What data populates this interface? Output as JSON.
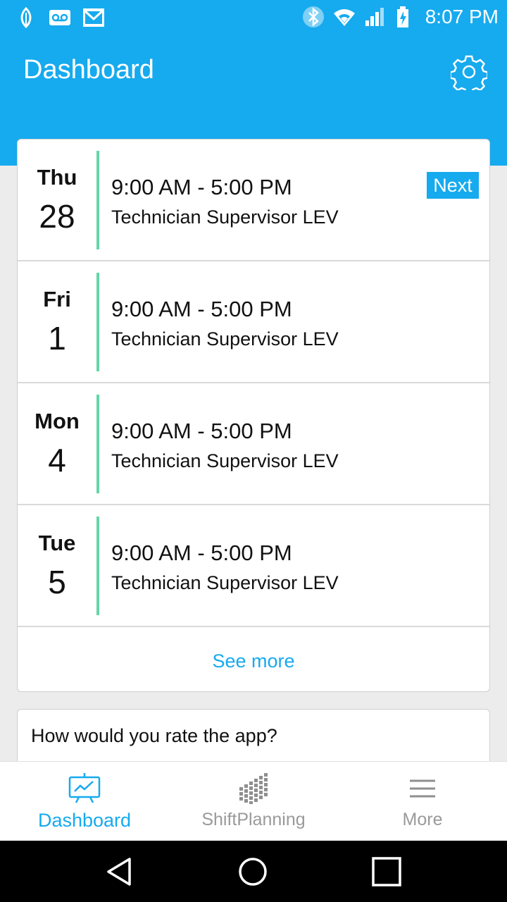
{
  "status_bar": {
    "time": "8:07 PM"
  },
  "header": {
    "title": "Dashboard"
  },
  "shifts": [
    {
      "day": "Thu",
      "date": "28",
      "time": "9:00 AM - 5:00 PM",
      "role": "Technician Supervisor LEV",
      "badge": "Next"
    },
    {
      "day": "Fri",
      "date": "1",
      "time": "9:00 AM - 5:00 PM",
      "role": "Technician Supervisor LEV"
    },
    {
      "day": "Mon",
      "date": "4",
      "time": "9:00 AM - 5:00 PM",
      "role": "Technician Supervisor LEV"
    },
    {
      "day": "Tue",
      "date": "5",
      "time": "9:00 AM - 5:00 PM",
      "role": "Technician Supervisor LEV"
    }
  ],
  "see_more": "See more",
  "rate_card": {
    "question": "How would you rate the app?"
  },
  "bottom_nav": {
    "items": [
      {
        "label": "Dashboard",
        "icon": "dashboard-chart-icon",
        "active": true
      },
      {
        "label": "ShiftPlanning",
        "icon": "shiftplanning-grid-icon",
        "active": false
      },
      {
        "label": "More",
        "icon": "menu-icon",
        "active": false
      }
    ]
  },
  "colors": {
    "brand": "#16aaee",
    "accent": "#66d5a8"
  }
}
